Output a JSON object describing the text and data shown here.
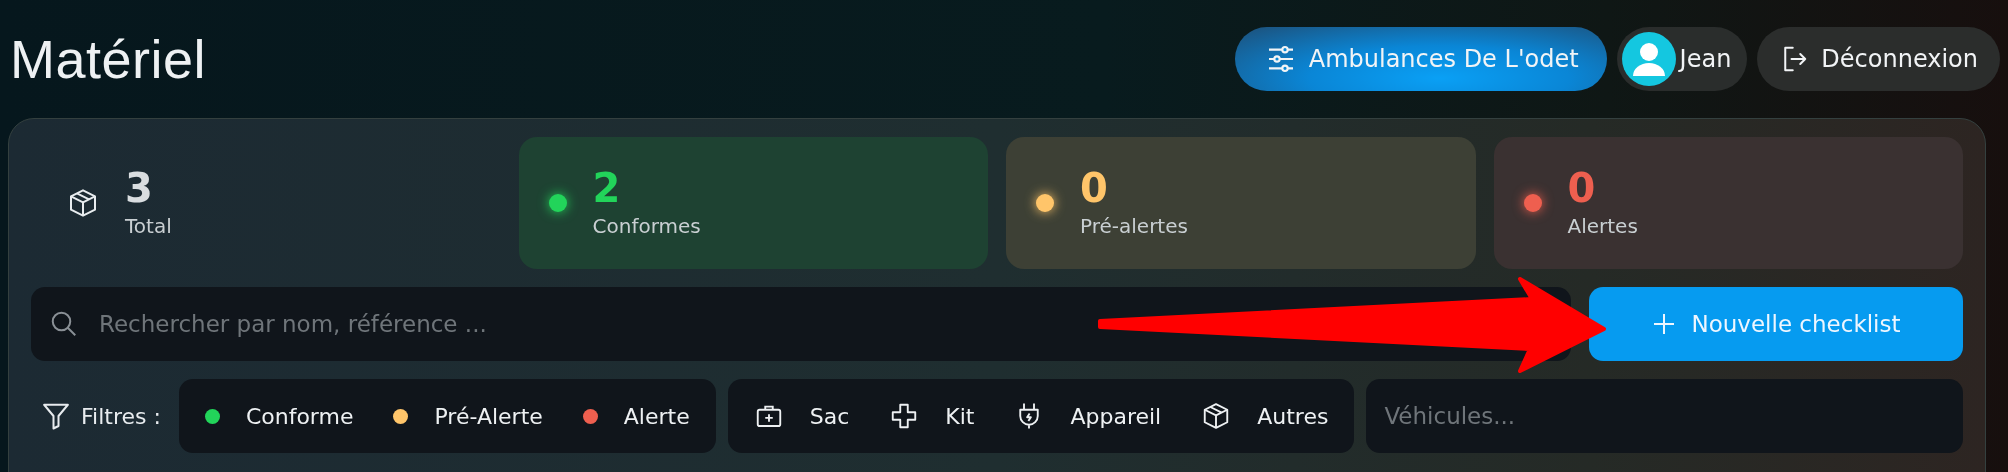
{
  "page": {
    "title": "Matériel"
  },
  "header": {
    "organization": {
      "label": "Ambulances De L'odet"
    },
    "user": {
      "name": "Jean"
    },
    "logout": {
      "label": "Déconnexion"
    }
  },
  "stats": [
    {
      "kind": "total",
      "value": "3",
      "label": "Total"
    },
    {
      "kind": "status",
      "value": "2",
      "label": "Conformes",
      "color": "#22d45a"
    },
    {
      "kind": "status",
      "value": "0",
      "label": "Pré-alertes",
      "color": "#ffc56a"
    },
    {
      "kind": "status",
      "value": "0",
      "label": "Alertes",
      "color": "#ee5f4f"
    }
  ],
  "search": {
    "placeholder": "Rechercher par nom, référence ..."
  },
  "new_button": {
    "label": "Nouvelle checklist"
  },
  "annotation": {
    "kind": "arrow"
  },
  "filters": {
    "label": "Filtres :",
    "statuses": [
      {
        "label": "Conforme",
        "color": "#22d45a"
      },
      {
        "label": "Pré-Alerte",
        "color": "#ffc56a"
      },
      {
        "label": "Alerte",
        "color": "#ee5f4f"
      }
    ],
    "types": [
      {
        "label": "Sac",
        "kind": "bag"
      },
      {
        "label": "Kit",
        "kind": "cross"
      },
      {
        "label": "Appareil",
        "kind": "plug"
      },
      {
        "label": "Autres",
        "kind": "box"
      }
    ],
    "vehicles": {
      "placeholder": "Véhicules..."
    }
  }
}
